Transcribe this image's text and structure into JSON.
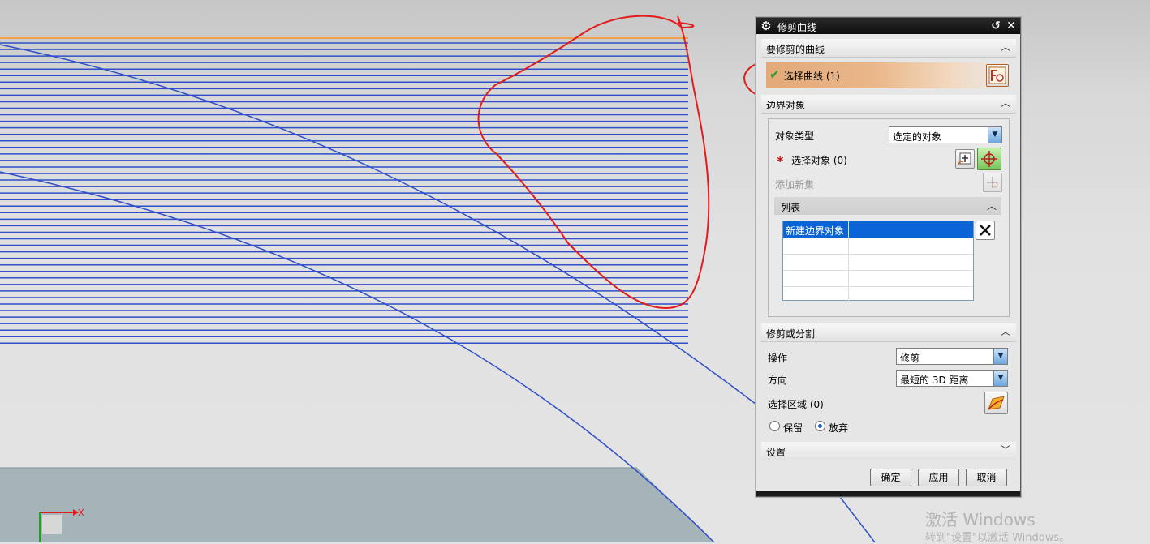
{
  "dialog": {
    "title": "修剪曲线",
    "sections": {
      "curves": {
        "title": "要修剪的曲线",
        "select_label": "选择曲线 (1)"
      },
      "boundary": {
        "title": "边界对象",
        "object_type_label": "对象类型",
        "object_type_value": "选定的对象",
        "required_mark": "*",
        "select_objects_label": "选择对象 (0)",
        "add_new_set_label": "添加新集",
        "list": {
          "title": "列表",
          "rows": [
            "新建边界对象",
            "",
            "",
            "",
            ""
          ]
        }
      },
      "trim": {
        "title": "修剪或分割",
        "operation_label": "操作",
        "operation_value": "修剪",
        "direction_label": "方向",
        "direction_value": "最短的 3D 距离",
        "select_region_label": "选择区域 (0)",
        "keep_label": "保留",
        "discard_label": "放弃",
        "selected_option": "放弃"
      },
      "settings": {
        "title": "设置"
      }
    },
    "buttons": {
      "ok": "确定",
      "apply": "应用",
      "cancel": "取消"
    }
  },
  "viewport": {
    "axis_label": "X",
    "watermark_title": "激活 Windows",
    "watermark_sub": "转到\"设置\"以激活 Windows。"
  },
  "icons": {
    "titlebar": [
      "gear-icon",
      "reset-icon",
      "close-icon"
    ],
    "curves": [
      "check-icon",
      "curve-select-icon"
    ],
    "boundary": [
      "point-dialog-icon",
      "crosshair-icon",
      "add-set-icon",
      "delete-x-icon"
    ],
    "trim": [
      "region-select-icon"
    ]
  },
  "colors": {
    "curve_lines": "#2e4fc9",
    "top_edge": "#f0a050",
    "annotation": "#e31b1b",
    "selected_row": "#0a64d6",
    "selection_highlight": "#e3a978"
  }
}
